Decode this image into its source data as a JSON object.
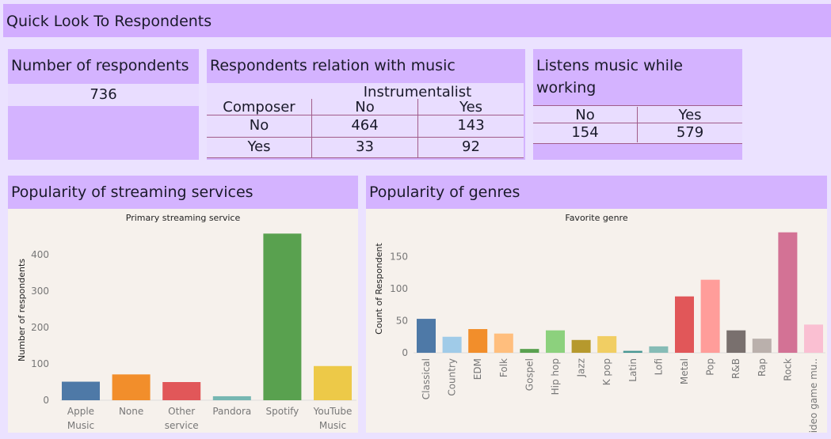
{
  "header": {
    "title": "Quick Look To Respondents"
  },
  "respondents": {
    "title": "Number of respondents",
    "value": "736"
  },
  "relation": {
    "title": "Respondents relation with music",
    "col_header": "Instrumentalist",
    "row_header": "Composer",
    "col_no": "No",
    "col_yes": "Yes",
    "rows": [
      {
        "label": "No",
        "no": "464",
        "yes": "143"
      },
      {
        "label": "Yes",
        "no": "33",
        "yes": "92"
      }
    ]
  },
  "working": {
    "title_line1": "Listens music while",
    "title_line2": "working",
    "col_no": "No",
    "col_yes": "Yes",
    "val_no": "154",
    "val_yes": "579"
  },
  "streaming_panel": {
    "title": "Popularity of streaming services"
  },
  "genres_panel": {
    "title": "Popularity of genres"
  },
  "chart_data": [
    {
      "type": "bar",
      "title": "Primary streaming service",
      "xlabel": "",
      "ylabel": "Number of respondents",
      "ylim": [
        0,
        460
      ],
      "yticks": [
        0,
        100,
        200,
        300,
        400
      ],
      "grid": false,
      "categories": [
        "Apple Music",
        "None",
        "Other service",
        "Pandora",
        "Spotify",
        "YouTube Music"
      ],
      "category_lines": [
        [
          "Apple",
          "Music"
        ],
        [
          "None"
        ],
        [
          "Other",
          "service"
        ],
        [
          "Pandora"
        ],
        [
          "Spotify"
        ],
        [
          "YouTube",
          "Music"
        ]
      ],
      "values": [
        51,
        71,
        50,
        11,
        458,
        94
      ],
      "colors": [
        "#4e79a7",
        "#f28e2b",
        "#e15759",
        "#76b7b2",
        "#59a14f",
        "#edc948"
      ]
    },
    {
      "type": "bar",
      "title": "Favorite genre",
      "xlabel": "",
      "ylabel": "Count of Respondent",
      "ylim": [
        0,
        190
      ],
      "yticks": [
        0,
        50,
        100,
        150
      ],
      "grid": false,
      "categories": [
        "Classical",
        "Country",
        "EDM",
        "Folk",
        "Gospel",
        "Hip hop",
        "Jazz",
        "K pop",
        "Latin",
        "Lofi",
        "Metal",
        "Pop",
        "R&B",
        "Rap",
        "Rock",
        "Video game mu.."
      ],
      "values": [
        53,
        25,
        37,
        30,
        6,
        35,
        20,
        26,
        3,
        10,
        88,
        114,
        35,
        22,
        188,
        44
      ],
      "colors": [
        "#4e79a7",
        "#a0cbe8",
        "#f28e2b",
        "#ffbe7d",
        "#59a14f",
        "#8cd17d",
        "#b6992d",
        "#f1ce63",
        "#499894",
        "#86bcb6",
        "#e15759",
        "#ff9d9a",
        "#79706e",
        "#bab0ac",
        "#d37295",
        "#fabfd2"
      ]
    }
  ]
}
